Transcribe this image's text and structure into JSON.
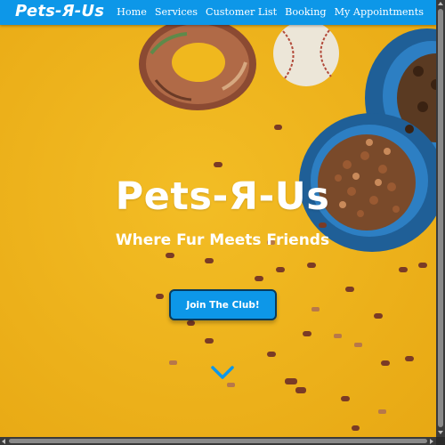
{
  "navbar": {
    "brand": "Pets-Я-Us",
    "links": [
      "Home",
      "Services",
      "Customer List",
      "Booking",
      "My Appointments"
    ]
  },
  "hero": {
    "title": "Pets-Я-Us",
    "tagline": "Where Fur Meets Friends",
    "cta_label": "Join The Club!"
  },
  "colors": {
    "navbar": "#0d97e8",
    "background": "#f2b81f",
    "button": "#0d97e8",
    "button_border": "#0a3b5c",
    "chevron": "#0d97e8"
  },
  "icons": {
    "scroll_down": "chevron-down-icon"
  }
}
